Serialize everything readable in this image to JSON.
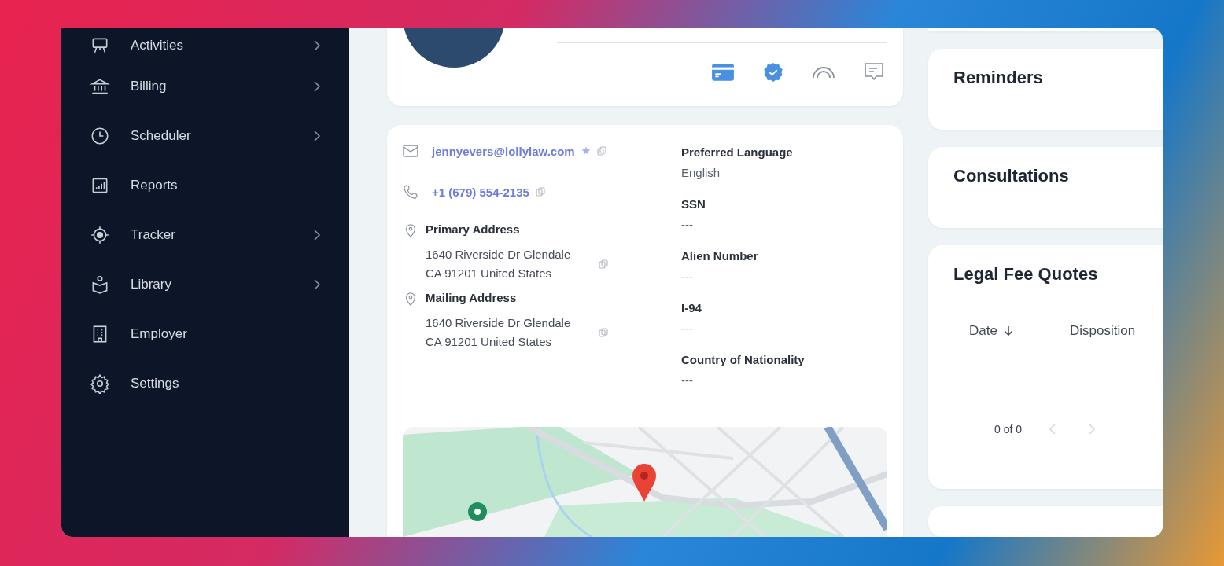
{
  "sidebar": {
    "items": [
      {
        "label": "Activities",
        "expandable": true
      },
      {
        "label": "Billing",
        "expandable": true
      },
      {
        "label": "Scheduler",
        "expandable": true
      },
      {
        "label": "Reports",
        "expandable": false
      },
      {
        "label": "Tracker",
        "expandable": true
      },
      {
        "label": "Library",
        "expandable": true
      },
      {
        "label": "Employer",
        "expandable": false
      },
      {
        "label": "Settings",
        "expandable": false
      }
    ]
  },
  "contact": {
    "email": "jennyevers@lollylaw.com",
    "phone": "+1 (679) 554-2135",
    "addresses": [
      {
        "label": "Primary Address",
        "lines": [
          "1640 Riverside Dr Glendale",
          "CA 91201 United States"
        ]
      },
      {
        "label": "Mailing Address",
        "lines": [
          "1640 Riverside Dr Glendale",
          "CA 91201 United States"
        ]
      }
    ],
    "fields": [
      {
        "label": "Preferred Language",
        "value": "English"
      },
      {
        "label": "SSN",
        "value": "---"
      },
      {
        "label": "Alien Number",
        "value": "---"
      },
      {
        "label": "I-94",
        "value": "---"
      },
      {
        "label": "Country of Nationality",
        "value": "---"
      }
    ]
  },
  "reminders": {
    "title": "Reminders"
  },
  "consultations": {
    "title": "Consultations"
  },
  "legal_fee_quotes": {
    "title": "Legal Fee Quotes",
    "columns": [
      {
        "label": "Date",
        "sorted_descending": true
      },
      {
        "label": "Disposition",
        "sorted_descending": false
      }
    ],
    "pagination": {
      "range": "0 of 0",
      "prev_disabled": true,
      "next_disabled": true
    }
  }
}
